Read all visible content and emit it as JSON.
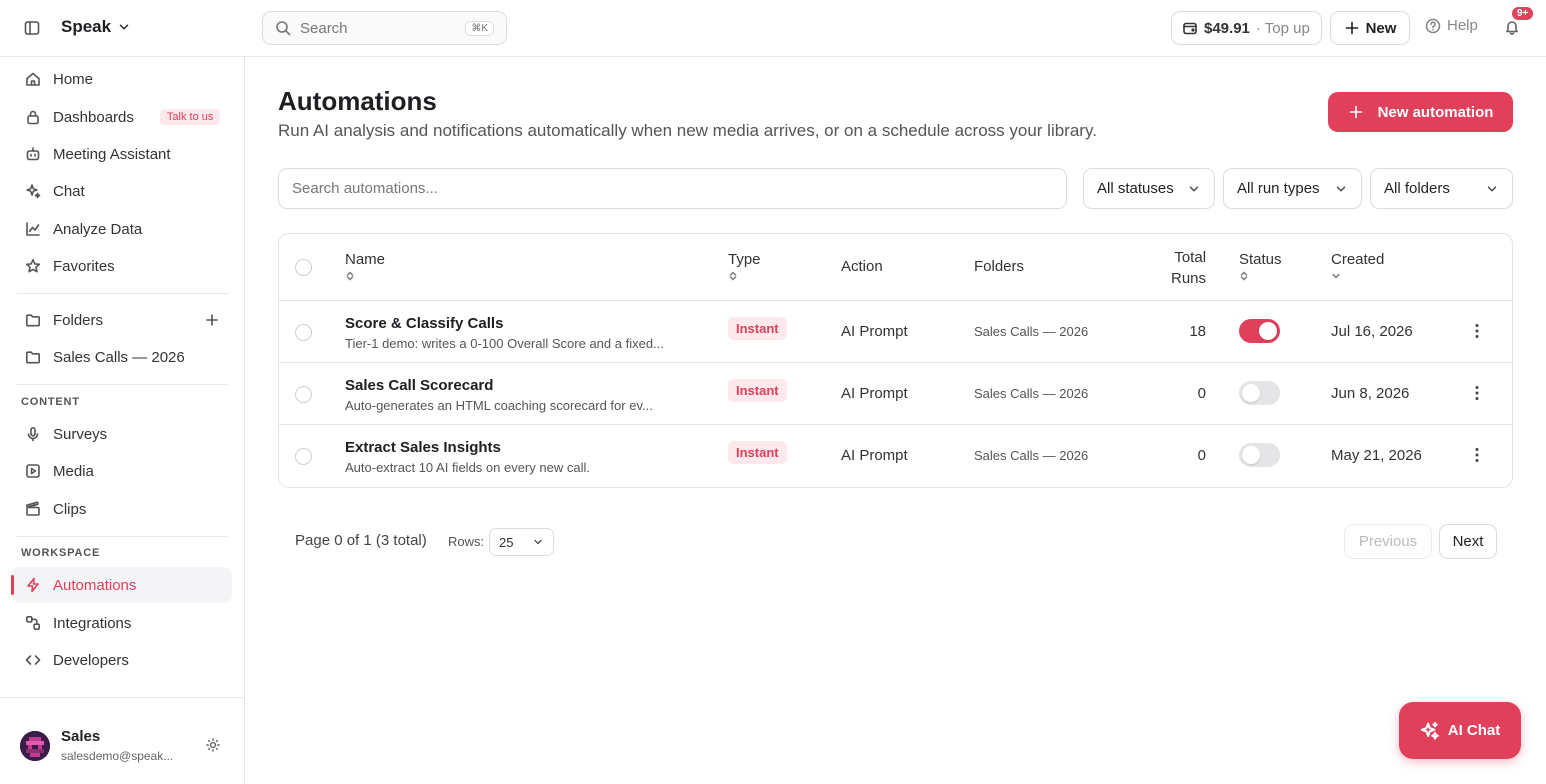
{
  "app": {
    "brand": "Speak",
    "search_placeholder": "Search",
    "search_shortcut": "⌘K",
    "balance": "$49.91",
    "balance_action": "· Top up",
    "new_label": "New",
    "help_label": "Help",
    "notification_count": "9+"
  },
  "sidebar": {
    "main_items": [
      {
        "label": "Home",
        "icon": "home-icon"
      },
      {
        "label": "Dashboards",
        "icon": "lock-icon",
        "badge": "Talk to us"
      },
      {
        "label": "Meeting Assistant",
        "icon": "bot-icon"
      },
      {
        "label": "Chat",
        "icon": "sparkles-icon"
      },
      {
        "label": "Analyze Data",
        "icon": "chart-line-icon"
      },
      {
        "label": "Favorites",
        "icon": "star-icon"
      }
    ],
    "folders_label": "Folders",
    "folder_items": [
      "Sales Calls — 2026"
    ],
    "content_heading": "CONTENT",
    "content_items": [
      {
        "label": "Surveys",
        "icon": "mic-icon"
      },
      {
        "label": "Media",
        "icon": "play-square-icon"
      },
      {
        "label": "Clips",
        "icon": "clapperboard-icon"
      }
    ],
    "workspace_heading": "WORKSPACE",
    "workspace_items": [
      {
        "label": "Automations",
        "icon": "zap-icon",
        "active": true
      },
      {
        "label": "Integrations",
        "icon": "link-icon"
      },
      {
        "label": "Developers",
        "icon": "code-icon"
      }
    ],
    "user": {
      "name": "Sales",
      "email": "salesdemo@speak..."
    }
  },
  "page": {
    "title": "Automations",
    "subtitle": "Run AI analysis and notifications automatically when new media arrives, or on a schedule across your library.",
    "new_button": "New automation",
    "search_placeholder": "Search automations...",
    "filters": {
      "status": "All statuses",
      "run_type": "All run types",
      "folder": "All folders"
    }
  },
  "table": {
    "columns": {
      "name": "Name",
      "type": "Type",
      "action": "Action",
      "folders": "Folders",
      "total_runs_1": "Total",
      "total_runs_2": "Runs",
      "status": "Status",
      "created": "Created"
    },
    "rows": [
      {
        "name": "Score & Classify Calls",
        "desc": "Tier-1 demo: writes a 0-100 Overall Score and a fixed...",
        "type": "Instant",
        "action": "AI Prompt",
        "folder": "Sales Calls — 2026",
        "runs": "18",
        "enabled": true,
        "created": "Jul 16, 2026"
      },
      {
        "name": "Sales Call Scorecard",
        "desc": "Auto-generates an HTML coaching scorecard for ev...",
        "type": "Instant",
        "action": "AI Prompt",
        "folder": "Sales Calls — 2026",
        "runs": "0",
        "enabled": false,
        "created": "Jun 8, 2026"
      },
      {
        "name": "Extract Sales Insights",
        "desc": "Auto-extract 10 AI fields on every new call.",
        "type": "Instant",
        "action": "AI Prompt",
        "folder": "Sales Calls — 2026",
        "runs": "0",
        "enabled": false,
        "created": "May 21, 2026"
      }
    ]
  },
  "pagination": {
    "summary": "Page 0 of 1 (3 total)",
    "rows_label": "Rows:",
    "rows_value": "25",
    "previous": "Previous",
    "next": "Next"
  },
  "ai_chat_label": "AI Chat",
  "colors": {
    "accent": "#e0405a",
    "border": "#e4e4e7"
  }
}
